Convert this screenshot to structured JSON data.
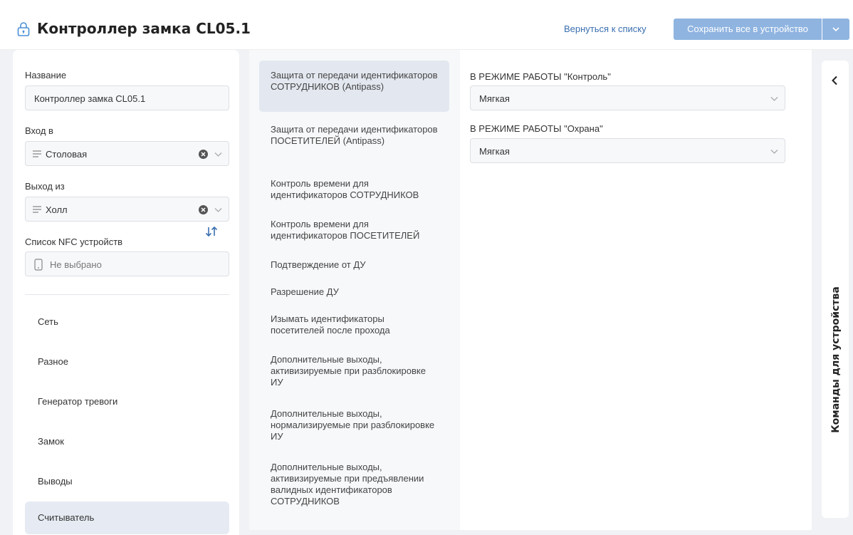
{
  "header": {
    "title": "Контроллер замка CL05.1",
    "icon": "lock-icon",
    "back_link": "Вернуться к списку",
    "save_button": "Сохранить все в устройство",
    "accent": "#8fb4e0"
  },
  "left_panel": {
    "name_label": "Название",
    "name_value": "Контроллер замка CL05.1",
    "entry_label": "Вход в",
    "entry_value": "Столовая",
    "exit_label": "Выход из",
    "exit_value": "Холл",
    "nfc_label": "Список NFC устройств",
    "nfc_value": "Не выбрано",
    "nav_items": [
      {
        "label": "Сеть",
        "active": false
      },
      {
        "label": "Разное",
        "active": false
      },
      {
        "label": "Генератор тревоги",
        "active": false
      },
      {
        "label": "Замок",
        "active": false
      },
      {
        "label": "Выводы",
        "active": false
      },
      {
        "label": "Считыватель",
        "active": true
      }
    ]
  },
  "middle_panel": {
    "items": [
      {
        "label": "Защита от передачи идентификаторов СОТРУДНИКОВ (Antipass)",
        "active": true
      },
      {
        "label": "Защита от передачи идентификаторов ПОСЕТИТЕЛЕЙ (Antipass)",
        "active": false
      },
      {
        "label": "Контроль времени для идентификаторов СОТРУДНИКОВ",
        "active": false
      },
      {
        "label": "Контроль времени для идентификаторов ПОСЕТИТЕЛЕЙ",
        "active": false
      },
      {
        "label": "Подтверждение от ДУ",
        "active": false
      },
      {
        "label": "Разрешение ДУ",
        "active": false
      },
      {
        "label": "Изымать идентификаторы посетителей после прохода",
        "active": false
      },
      {
        "label": "Дополнительные выходы, активизируемые при разблокировке ИУ",
        "active": false
      },
      {
        "label": "Дополнительные выходы, нормализируемые при разблокировке ИУ",
        "active": false
      },
      {
        "label": "Дополнительные выходы, активизируемые при предъявлении валидных идентификаторов СОТРУДНИКОВ",
        "active": false
      }
    ]
  },
  "content": {
    "mode_control_label": "В РЕЖИМЕ РАБОТЫ \"Контроль\"",
    "mode_control_value": "Мягкая",
    "mode_guard_label": "В РЕЖИМЕ РАБОТЫ \"Охрана\"",
    "mode_guard_value": "Мягкая"
  },
  "side_panel": {
    "title": "Команды для устройства"
  }
}
